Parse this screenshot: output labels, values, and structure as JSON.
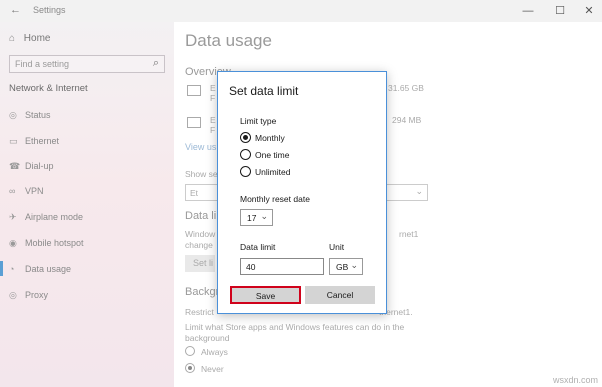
{
  "window": {
    "title": "Settings",
    "back_icon": "back-arrow-icon",
    "minimize": "—",
    "maximize": "☐",
    "close": "✕"
  },
  "sidebar": {
    "home": "Home",
    "search_placeholder": "Find a setting",
    "section": "Network & Internet",
    "items": [
      {
        "label": "Status",
        "icon": "globe-icon"
      },
      {
        "label": "Ethernet",
        "icon": "ethernet-icon"
      },
      {
        "label": "Dial-up",
        "icon": "phone-icon"
      },
      {
        "label": "VPN",
        "icon": "vpn-icon"
      },
      {
        "label": "Airplane mode",
        "icon": "airplane-icon"
      },
      {
        "label": "Mobile hotspot",
        "icon": "hotspot-icon"
      },
      {
        "label": "Data usage",
        "icon": "data-usage-icon",
        "active": true
      },
      {
        "label": "Proxy",
        "icon": "globe-icon"
      }
    ]
  },
  "main": {
    "title": "Data usage",
    "overview_heading": "Overview",
    "item1_prefix": "E",
    "item1_sub": "F",
    "item1_value": "31.65 GB",
    "item2_prefix": "E",
    "item2_sub": "F",
    "item2_value": "294 MB",
    "view_usage_link": "View us",
    "show_settings_label": "Show se",
    "combo_value": "Et",
    "data_limit_heading": "Data li",
    "data_limit_desc1": "Window",
    "data_limit_desc1_right": "rnet1",
    "data_limit_desc2": "change",
    "set_limit_button": "Set li",
    "background_heading": "Backgr",
    "background_desc1": "Restrict",
    "background_desc1_right": "thernet1.",
    "background_desc2": "Limit what Store apps and Windows features can do in the",
    "background_desc3": "background",
    "radio_always": "Always",
    "radio_never": "Never"
  },
  "dialog": {
    "title": "Set data limit",
    "limit_type_label": "Limit type",
    "options": [
      "Monthly",
      "One time",
      "Unlimited"
    ],
    "selected_option": "Monthly",
    "reset_date_label": "Monthly reset date",
    "reset_date_value": "17",
    "data_limit_label": "Data limit",
    "data_limit_value": "40",
    "unit_label": "Unit",
    "unit_value": "GB",
    "save_label": "Save",
    "cancel_label": "Cancel",
    "highlight_color": "#d0021b"
  },
  "watermark": "wsxdn.com"
}
